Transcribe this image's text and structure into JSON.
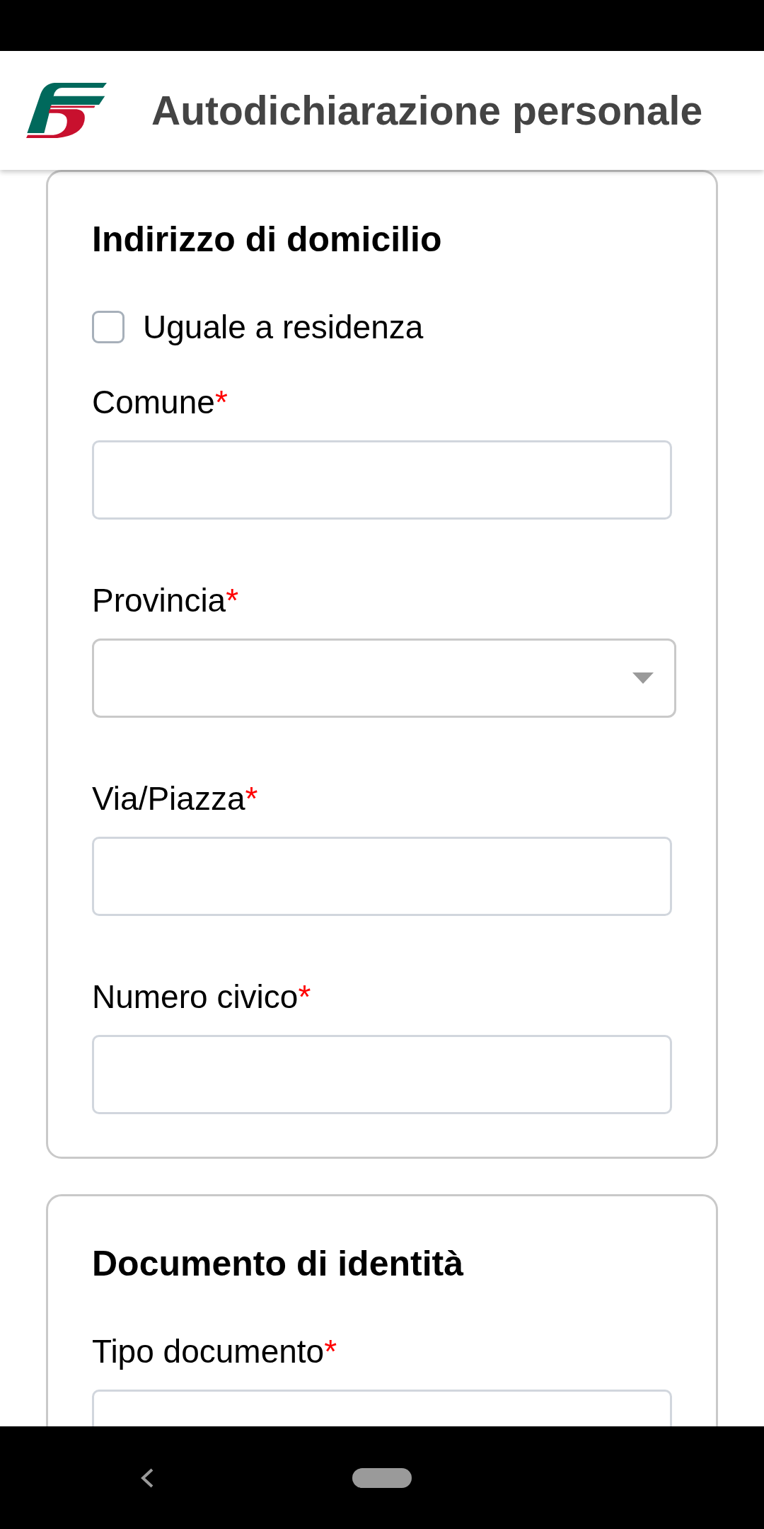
{
  "app_bar": {
    "title": "Autodichiarazione personale"
  },
  "sections": [
    {
      "title": "Indirizzo di domicilio",
      "fields": [
        {
          "kind": "checkbox",
          "label": "Uguale a residenza",
          "checked": false
        },
        {
          "kind": "text",
          "label": "Comune",
          "required_mark": "*"
        },
        {
          "kind": "select",
          "label": "Provincia",
          "required_mark": "*"
        },
        {
          "kind": "text",
          "label": "Via/Piazza",
          "required_mark": "*"
        },
        {
          "kind": "text",
          "label": "Numero civico",
          "required_mark": "*"
        }
      ]
    },
    {
      "title": "Documento di identità",
      "fields": [
        {
          "kind": "text",
          "label": "Tipo documento",
          "required_mark": "*"
        }
      ]
    }
  ]
}
